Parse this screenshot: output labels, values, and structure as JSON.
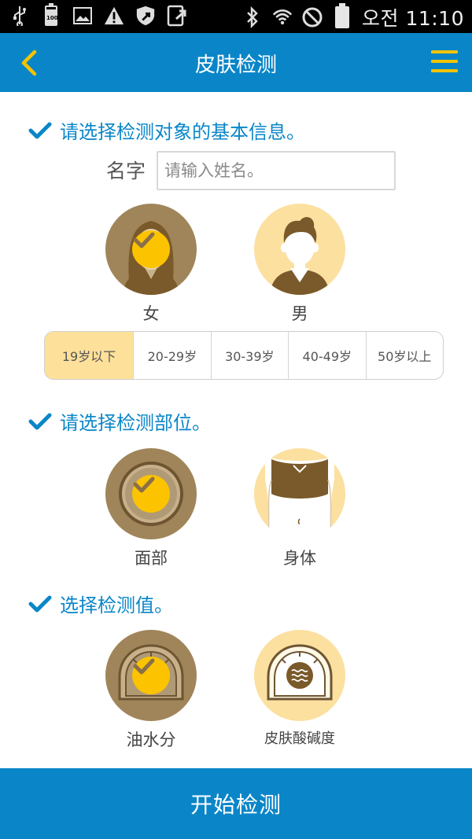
{
  "status_bar": {
    "time": "오전 11:10",
    "battery_small_text": "100",
    "icons": [
      "usb-icon",
      "battery-icon",
      "image-icon",
      "warning-icon",
      "shield-icon",
      "screen-share-icon",
      "bluetooth-icon",
      "wifi-icon",
      "no-sign-icon",
      "battery-full-icon"
    ]
  },
  "header": {
    "title": "皮肤检测"
  },
  "section_basic": {
    "heading": "请选择检测对象的基本信息。"
  },
  "name_field": {
    "label": "名字",
    "placeholder": "请输入姓名。",
    "value": ""
  },
  "gender": {
    "options": [
      {
        "label": "女",
        "selected": true
      },
      {
        "label": "男",
        "selected": false
      }
    ]
  },
  "age_tabs": [
    {
      "label": "19岁以下",
      "active": true
    },
    {
      "label": "20-29岁",
      "active": false
    },
    {
      "label": "30-39岁",
      "active": false
    },
    {
      "label": "40-49岁",
      "active": false
    },
    {
      "label": "50岁以上",
      "active": false
    }
  ],
  "section_area": {
    "heading": "请选择检测部位。"
  },
  "area": {
    "options": [
      {
        "label": "面部",
        "selected": true
      },
      {
        "label": "身体",
        "selected": false
      }
    ]
  },
  "section_value": {
    "heading": "选择检测值。"
  },
  "measure": {
    "options": [
      {
        "label": "油水分",
        "selected": true
      },
      {
        "label": "皮肤酸碱度",
        "selected": false
      }
    ]
  },
  "start_button": {
    "label": "开始检测"
  },
  "colors": {
    "primary": "#0a86c8",
    "accent": "#fcc300",
    "selected_bg": "#a0855a",
    "unselected_bg": "#fce0a0",
    "tab_active": "#fde09a"
  }
}
